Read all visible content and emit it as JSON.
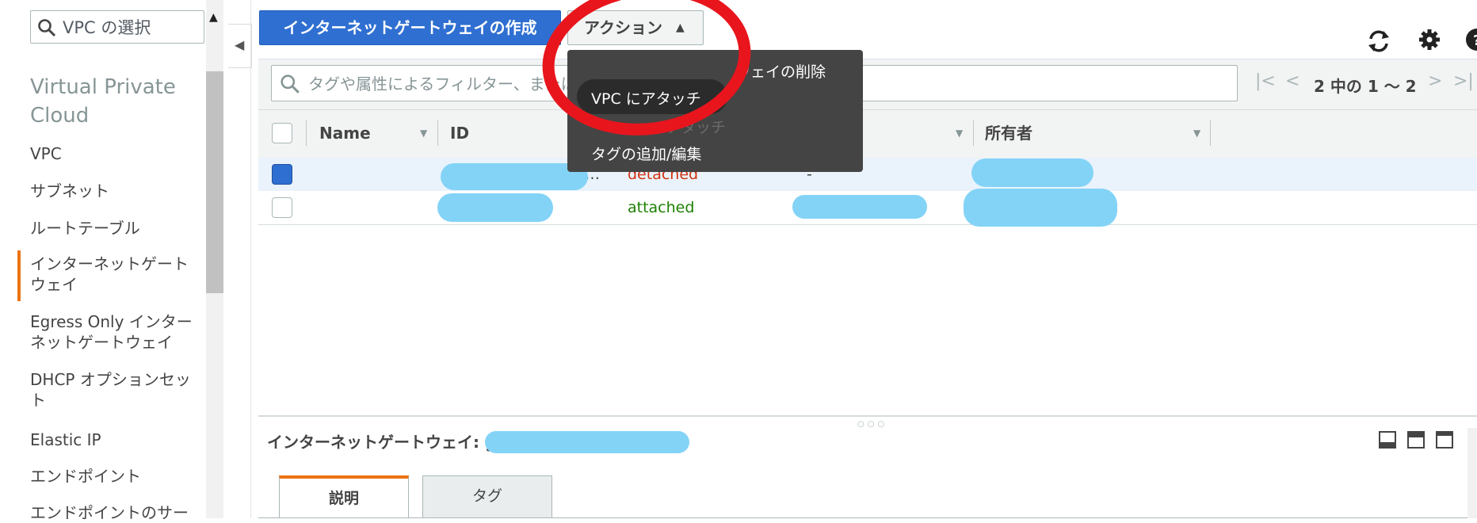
{
  "sidebar": {
    "vpc_select_placeholder": "VPC の選択",
    "heading": "Virtual Private Cloud",
    "items": [
      {
        "label": "VPC"
      },
      {
        "label": "サブネット"
      },
      {
        "label": "ルートテーブル"
      },
      {
        "label": "インターネットゲートウェイ",
        "active": true
      },
      {
        "label": "Egress Only インターネットゲートウェイ"
      },
      {
        "label": "DHCP オプションセット"
      },
      {
        "label": "Elastic IP"
      },
      {
        "label": "エンドポイント"
      },
      {
        "label": "エンドポイントのサー"
      }
    ]
  },
  "toolbar": {
    "create_label": "インターネットゲートウェイの作成",
    "actions_label": "アクション",
    "refresh_icon": "refresh-icon",
    "settings_icon": "gear-icon",
    "help_icon": "help-icon"
  },
  "filter": {
    "placeholder": "タグや属性によるフィルター、または"
  },
  "pagination": {
    "label": "2 中の 1 ～ 2"
  },
  "table": {
    "columns": [
      "Name",
      "ID",
      "所有者"
    ],
    "rows": [
      {
        "name": "",
        "id": "…",
        "state": "detached",
        "vpc": "-",
        "owner": "",
        "selected": true
      },
      {
        "name": "",
        "id": "",
        "state": "attached",
        "vpc": "",
        "owner": "",
        "selected": false
      }
    ]
  },
  "actions_menu": {
    "items": [
      {
        "label": "ウェイの削除"
      },
      {
        "label": "VPC にアタッチ"
      },
      {
        "label": "デタッチ"
      },
      {
        "label": "タグの追加/編集"
      }
    ]
  },
  "detail": {
    "title": "インターネットゲートウェイ: g",
    "tabs": [
      {
        "label": "説明",
        "active": true
      },
      {
        "label": "タグ",
        "active": false
      }
    ]
  },
  "colors": {
    "primary_button": "#2f6fd1",
    "accent_orange": "#ec7211",
    "detached_red": "#d13212",
    "attached_green": "#1d8102",
    "annotation_red": "#e8151d",
    "redaction_blue": "#83d3f7"
  }
}
